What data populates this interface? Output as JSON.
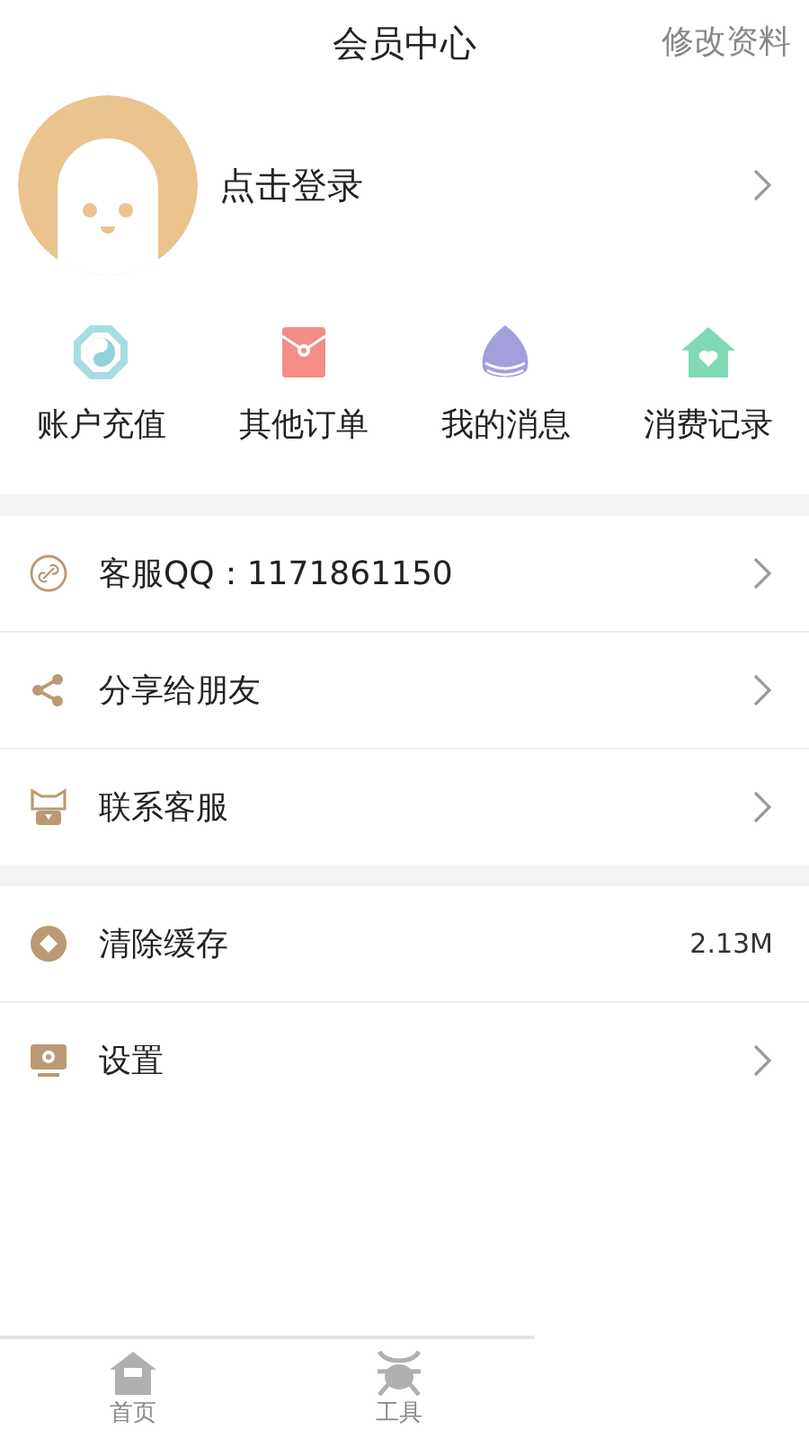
{
  "header": {
    "title": "会员中心",
    "action": "修改资料"
  },
  "profile": {
    "login_label": "点击登录"
  },
  "shortcuts": [
    {
      "label": "账户充值"
    },
    {
      "label": "其他订单"
    },
    {
      "label": "我的消息"
    },
    {
      "label": "消费记录"
    }
  ],
  "menu_groups": [
    {
      "items": [
        {
          "kind": "link",
          "label": "客服QQ：1171861150"
        },
        {
          "kind": "link",
          "label": "分享给朋友"
        },
        {
          "kind": "link",
          "label": "联系客服"
        }
      ]
    },
    {
      "items": [
        {
          "kind": "value",
          "label": "清除缓存",
          "value": "2.13M"
        },
        {
          "kind": "link",
          "label": "设置"
        }
      ]
    }
  ],
  "bottom_nav": [
    {
      "label": "首页"
    },
    {
      "label": "工具"
    }
  ]
}
